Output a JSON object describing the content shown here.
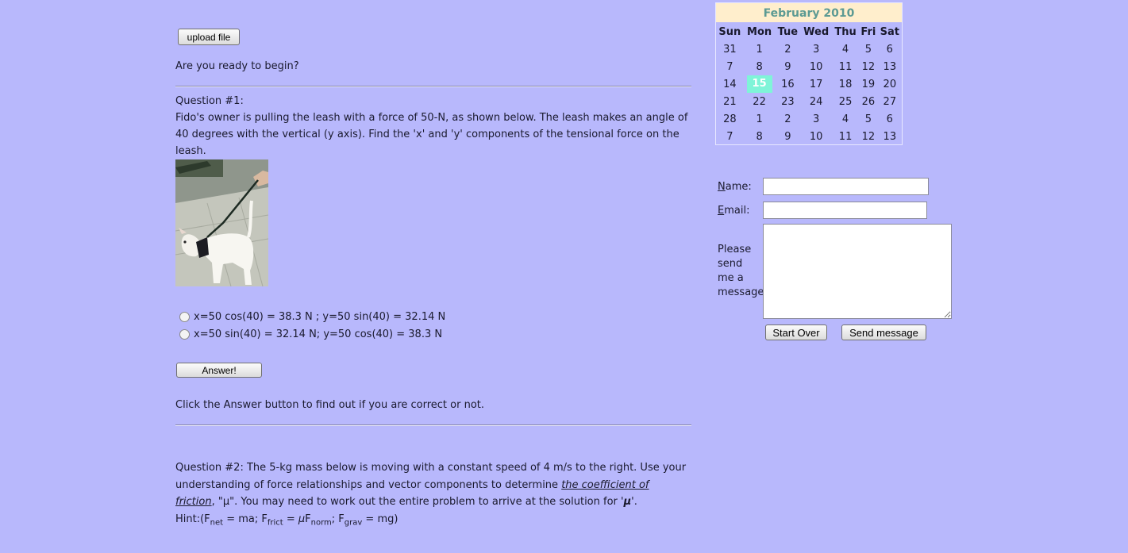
{
  "upload_label": "upload file",
  "intro_text": "Are you ready to begin?",
  "q1": {
    "title": "Question #1:",
    "body": "Fido's owner is pulling the leash with a force of 50-N, as shown below. The leash makes an angle of 40 degrees with the vertical (y axis). Find the 'x' and 'y' components of the tensional force on the leash.",
    "options": [
      "x=50 cos(40) = 38.3 N ; y=50 sin(40) = 32.14 N",
      "x=50 sin(40) = 32.14 N; y=50 cos(40) = 38.3 N"
    ],
    "answer_label": "Answer!",
    "feedback": "Click the Answer button to find out if you are correct or not."
  },
  "q2": {
    "body_start": "Question #2: The 5-kg mass below is moving with a constant speed of 4 m/s to the right. Use your understanding of force relationships and vector components to determine ",
    "link_text": "the coefficient of friction",
    "body_end": ", \"µ\". You may need to work out the entire problem to arrive at the solution for '",
    "mu_symbol": "µ",
    "quote_end": "'.",
    "hint_prefix": "Hint:(F",
    "net": "net",
    "eq1": " = ma; F",
    "frict": "frict",
    "eq2": " = ",
    "mu_italic": "µ",
    "eq3": "F",
    "norm": "norm",
    "eq4": "; F",
    "grav": "grav",
    "eq5": " = mg)"
  },
  "calendar": {
    "title": "February 2010",
    "days": [
      "Sun",
      "Mon",
      "Tue",
      "Wed",
      "Thu",
      "Fri",
      "Sat"
    ],
    "weeks": [
      [
        "31",
        "1",
        "2",
        "3",
        "4",
        "5",
        "6"
      ],
      [
        "7",
        "8",
        "9",
        "10",
        "11",
        "12",
        "13"
      ],
      [
        "14",
        "15",
        "16",
        "17",
        "18",
        "19",
        "20"
      ],
      [
        "21",
        "22",
        "23",
        "24",
        "25",
        "26",
        "27"
      ],
      [
        "28",
        "1",
        "2",
        "3",
        "4",
        "5",
        "6"
      ],
      [
        "7",
        "8",
        "9",
        "10",
        "11",
        "12",
        "13"
      ]
    ],
    "today": "15",
    "highlight_color": "#7ff4d8",
    "header_bg": "#ffeecc"
  },
  "contact": {
    "name_first": "N",
    "name_rest": "ame:",
    "email_first": "E",
    "email_rest": "mail:",
    "message_label": "Please send me a message",
    "start_over": "Start Over",
    "send": "Send message",
    "name_value": "",
    "email_value": "",
    "message_value": ""
  },
  "colors": {
    "background": "#b8b8fc"
  }
}
